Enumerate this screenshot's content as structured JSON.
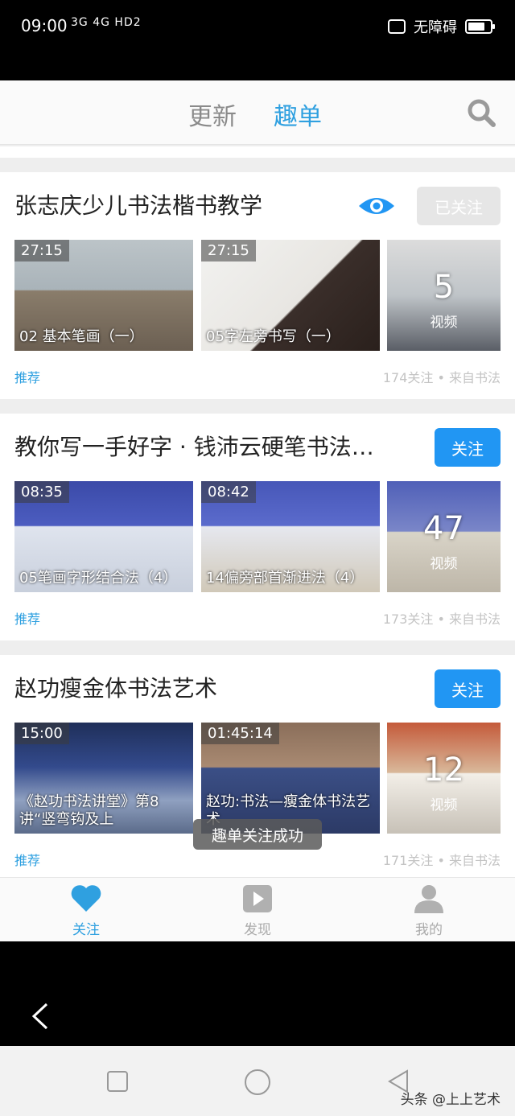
{
  "status_bar": {
    "time": "09:00",
    "network": "3G 4G HD2",
    "accessibility": "无障碍"
  },
  "top_tabs": {
    "update": "更新",
    "qudan": "趣单"
  },
  "cards": [
    {
      "title": "张志庆少儿书法楷书教学",
      "follow_label": "已关注",
      "followed": true,
      "videos": [
        {
          "duration": "27:15",
          "caption": "02 基本笔画（一）"
        },
        {
          "duration": "27:15",
          "caption": "05字左旁书写（一）"
        }
      ],
      "video_count": "5",
      "video_count_label": "视频",
      "tag": "推荐",
      "meta": "174关注 • 来自书法"
    },
    {
      "title": "教你写一手好字 · 钱沛云硬笔书法…",
      "follow_label": "关注",
      "followed": false,
      "videos": [
        {
          "duration": "08:35",
          "caption": "05笔画字形结合法（4）"
        },
        {
          "duration": "08:42",
          "caption": "14偏旁部首渐进法（4）"
        }
      ],
      "video_count": "47",
      "video_count_label": "视频",
      "tag": "推荐",
      "meta": "173关注 • 来自书法"
    },
    {
      "title": "赵功瘦金体书法艺术",
      "follow_label": "关注",
      "followed": false,
      "videos": [
        {
          "duration": "15:00",
          "caption": "《赵功书法讲堂》第8讲“竖弯钩及上"
        },
        {
          "duration": "01:45:14",
          "caption": "赵功:书法—瘦金体书法艺术"
        }
      ],
      "video_count": "12",
      "video_count_label": "视频",
      "tag": "推荐",
      "meta": "171关注 • 来自书法"
    }
  ],
  "toast": "趣单关注成功",
  "bottom_nav": {
    "follow": "关注",
    "discover": "发现",
    "mine": "我的"
  },
  "watermark": "头条 @上上艺术",
  "colors": {
    "accent": "#2fa0e0",
    "button_blue": "#2196f3",
    "followed_gray": "#e6e6e6"
  }
}
